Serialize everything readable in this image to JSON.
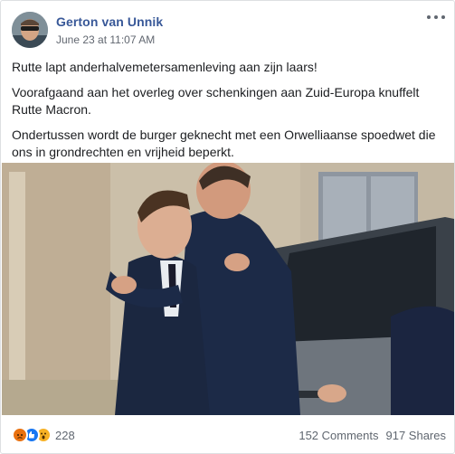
{
  "post": {
    "author": "Gerton van Unnik",
    "timestamp": "June 23 at 11:07 AM",
    "paragraphs": [
      "Rutte lapt anderhalvemetersamenleving aan zijn laars!",
      "Voorafgaand aan het overleg over schenkingen aan Zuid-Europa knuffelt Rutte Macron.",
      "Ondertussen wordt de burger geknecht met een Orwelliaanse spoedwet die ons in grondrechten en vrijheid beperkt."
    ]
  },
  "footer": {
    "reactions": [
      "angry-icon",
      "like-icon",
      "wow-icon"
    ],
    "reaction_count": "228",
    "comments": "152 Comments",
    "shares": "917 Shares"
  },
  "colors": {
    "author_link": "#385898",
    "meta_text": "#616770",
    "like_blue": "#1877f2",
    "angry_orange": "#e9710f",
    "wow_yellow": "#f7b125"
  }
}
